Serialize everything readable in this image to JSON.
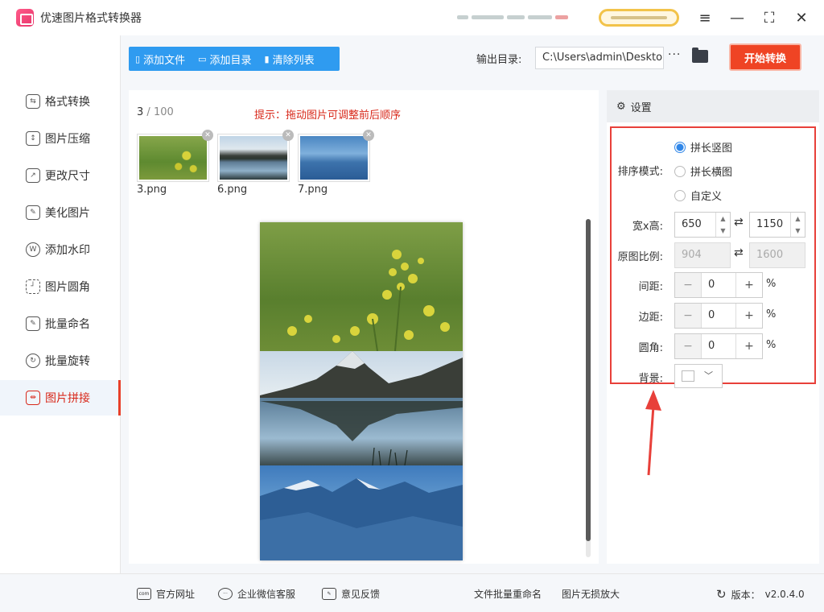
{
  "app": {
    "title": "优速图片格式转换器"
  },
  "window": {
    "menu_icon": "≡",
    "min_icon": "—",
    "max_icon": "⛶",
    "close_icon": "✕"
  },
  "sidebar": {
    "items": [
      {
        "label": "格式转换",
        "icon": "swap-icon"
      },
      {
        "label": "图片压缩",
        "icon": "compress-icon"
      },
      {
        "label": "更改尺寸",
        "icon": "resize-icon"
      },
      {
        "label": "美化图片",
        "icon": "beautify-icon"
      },
      {
        "label": "添加水印",
        "icon": "watermark-icon"
      },
      {
        "label": "图片圆角",
        "icon": "round-corner-icon"
      },
      {
        "label": "批量命名",
        "icon": "rename-icon"
      },
      {
        "label": "批量旋转",
        "icon": "rotate-icon"
      },
      {
        "label": "图片拼接",
        "icon": "stitch-icon",
        "active": true
      }
    ]
  },
  "toolbar": {
    "add_file": "添加文件",
    "add_folder": "添加目录",
    "clear_list": "清除列表",
    "output_label": "输出目录:",
    "output_path": "C:\\Users\\admin\\Desktop",
    "more": "···",
    "start": "开始转换"
  },
  "main": {
    "count_current": "3",
    "count_sep": " / ",
    "count_total": "100",
    "hint": "提示：拖动图片可调整前后顺序",
    "files": [
      {
        "name": "3.png",
        "theme": "flowers"
      },
      {
        "name": "6.png",
        "theme": "lake"
      },
      {
        "name": "7.png",
        "theme": "mountains"
      }
    ]
  },
  "settings": {
    "header": "设置",
    "sort_label": "排序模式:",
    "modes": [
      {
        "label": "拼长竖图",
        "selected": true
      },
      {
        "label": "拼长横图",
        "selected": false
      },
      {
        "label": "自定义",
        "selected": false
      }
    ],
    "size_label": "宽x高:",
    "width": "650",
    "height": "1150",
    "ratio_label": "原图比例:",
    "ratio_w": "904",
    "ratio_h": "1600",
    "spacing_label": "间距:",
    "spacing": "0",
    "margin_label": "边距:",
    "margin": "0",
    "corner_label": "圆角:",
    "corner": "0",
    "percent": "%",
    "bg_label": "背景:",
    "bg_color": "#ffffff"
  },
  "footer": {
    "website": "官方网址",
    "wechat": "企业微信客服",
    "feedback": "意见反馈",
    "batch_rename": "文件批量重命名",
    "lossless": "图片无损放大",
    "version_label": "版本：",
    "version": "v2.0.4.0"
  },
  "colors": {
    "accent_blue": "#2f9bf0",
    "start_red": "#ef4424",
    "active_red": "#d8281a",
    "annotation_red": "#e8403a"
  }
}
